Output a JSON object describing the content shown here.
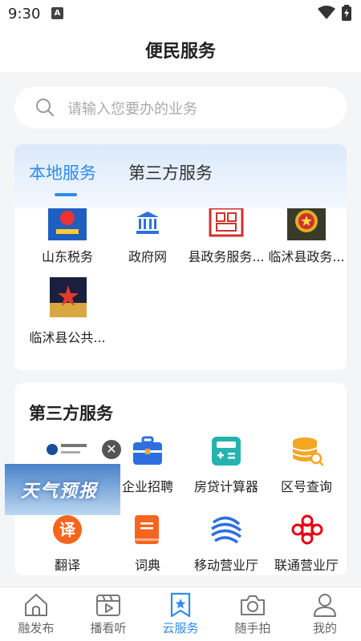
{
  "status_bar": {
    "time": "9:30",
    "notification_letter": "A"
  },
  "header": {
    "title": "便民服务"
  },
  "search": {
    "placeholder": "请输入您要办的业务"
  },
  "tabs": {
    "local": "本地服务",
    "third_party": "第三方服务"
  },
  "local_services": [
    {
      "label": "山东税务",
      "icon": "tax-emblem-icon"
    },
    {
      "label": "政府网",
      "icon": "government-building-icon"
    },
    {
      "label": "县政务服务...",
      "icon": "red-seal-icon"
    },
    {
      "label": "临沭县政务...",
      "icon": "national-emblem-icon"
    },
    {
      "label": "临沭县公共...",
      "icon": "police-badge-icon"
    }
  ],
  "third_party": {
    "title": "第三方服务",
    "items": [
      {
        "label": "企业招聘",
        "icon": "briefcase-icon",
        "color": "#2e6fe0"
      },
      {
        "label": "房贷计算器",
        "icon": "calculator-icon",
        "color": "#26b3b0"
      },
      {
        "label": "区号查询",
        "icon": "database-search-icon",
        "color": "#f5a623"
      },
      {
        "label": "翻译",
        "icon": "translate-icon",
        "color": "#f5651e"
      },
      {
        "label": "词典",
        "icon": "book-icon",
        "color": "#f5651e"
      },
      {
        "label": "移动营业厅",
        "icon": "china-mobile-icon",
        "color": "#2e6fe0"
      },
      {
        "label": "联通营业厅",
        "icon": "china-unicom-icon",
        "color": "#e60012"
      }
    ]
  },
  "ad": {
    "text": "天气预报",
    "close": "✕"
  },
  "bottom_nav": [
    {
      "label": "融发布",
      "icon": "home-icon"
    },
    {
      "label": "播看听",
      "icon": "video-icon"
    },
    {
      "label": "云服务",
      "icon": "star-bookmark-icon",
      "active": true
    },
    {
      "label": "随手拍",
      "icon": "camera-icon"
    },
    {
      "label": "我的",
      "icon": "person-icon"
    }
  ],
  "colors": {
    "accent": "#2e8bf0",
    "background": "#f4f5f7"
  }
}
